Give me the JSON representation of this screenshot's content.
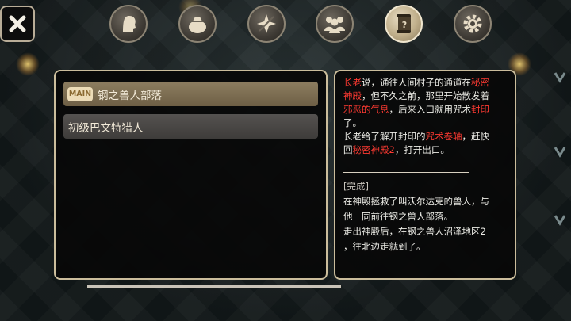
{
  "tabs": [
    {
      "name": "character-icon"
    },
    {
      "name": "bag-icon"
    },
    {
      "name": "skill-icon"
    },
    {
      "name": "party-icon"
    },
    {
      "name": "quest-scroll-icon",
      "active": true
    },
    {
      "name": "settings-gear-icon"
    }
  ],
  "quest_list": [
    {
      "badge": "MAIN",
      "title": "钢之兽人部落"
    },
    {
      "title": "初级巴文特猎人"
    }
  ],
  "quest_detail": {
    "l1_a": "长老",
    "l1_b": "说，通往人间村子的通道在",
    "l1_c": "秘密",
    "l2_a": "神殿",
    "l2_b": "，但不久之前，那里开始散发着",
    "l3_a": "邪恶的气息",
    "l3_b": "，后来入口就用咒术",
    "l3_c": "封印",
    "l4": "了。",
    "l5_a": "长老给了解开封印的",
    "l5_b": "咒术卷轴",
    "l5_c": "，赶快",
    "l6_a": "回",
    "l6_b": "秘密神殿2",
    "l6_c": "，打开出口。",
    "status": "[完成]",
    "done_lines": [
      "在神殿拯救了叫沃尔达克的兽人，与",
      "他一同前往钢之兽人部落。",
      "走出神殿后，在钢之兽人沼泽地区2",
      "，往北边走就到了。"
    ]
  },
  "colors": {
    "highlight": "#ff3a32",
    "panel_border": "#cbbd9c",
    "selected_item": "#8d7d60"
  }
}
